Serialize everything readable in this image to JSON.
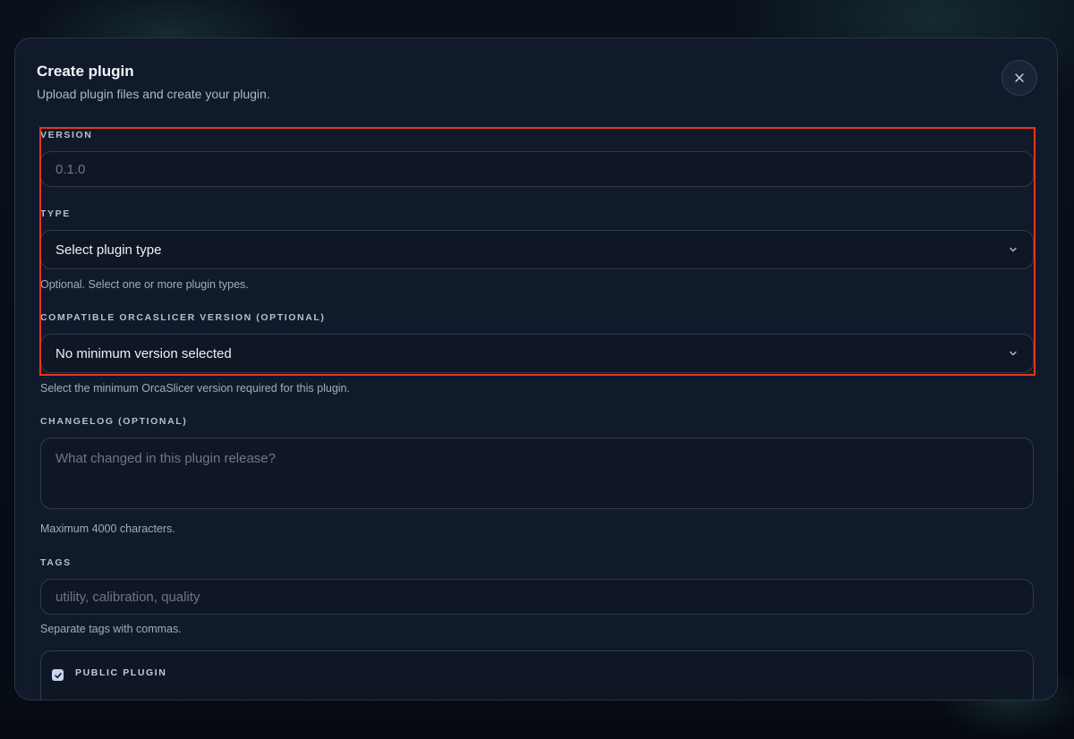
{
  "modal": {
    "title": "Create plugin",
    "subtitle": "Upload plugin files and create your plugin."
  },
  "form": {
    "version": {
      "label": "VERSION",
      "placeholder": "0.1.0"
    },
    "type": {
      "label": "TYPE",
      "selected": "Select plugin type",
      "help": "Optional. Select one or more plugin types."
    },
    "compatible_version": {
      "label": "COMPATIBLE ORCASLICER VERSION (OPTIONAL)",
      "selected": "No minimum version selected",
      "help": "Select the minimum OrcaSlicer version required for this plugin."
    },
    "changelog": {
      "label": "CHANGELOG (OPTIONAL)",
      "placeholder": "What changed in this plugin release?",
      "help": "Maximum 4000 characters."
    },
    "tags": {
      "label": "TAGS",
      "placeholder": "utility, calibration, quality",
      "help": "Separate tags with commas."
    },
    "public": {
      "label": "PUBLIC PLUGIN",
      "checked": true
    }
  },
  "icons": {
    "close": "close-icon",
    "chevron": "chevron-down-icon",
    "check": "check-icon"
  },
  "colors": {
    "highlight": "#e3371e",
    "modal_bg": "#111a2a",
    "field_bg": "#0f1725",
    "border": "#2e3a4e"
  }
}
